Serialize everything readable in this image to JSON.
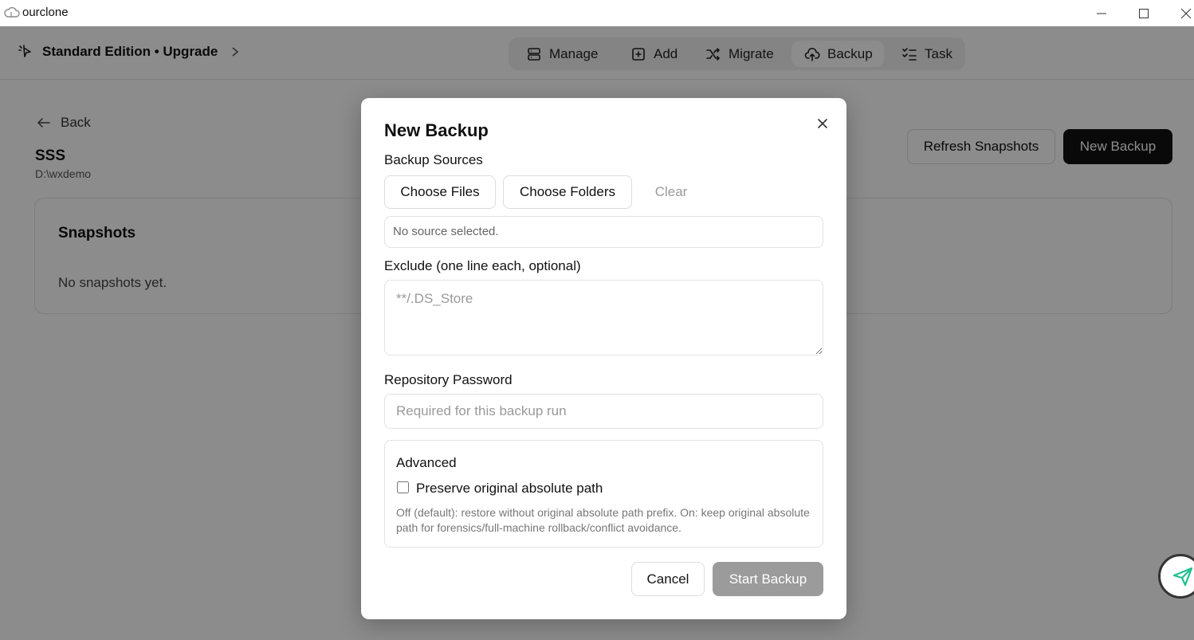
{
  "window": {
    "app_name": "ourclone",
    "icon": "cloud-icon",
    "controls": [
      "minimize-icon",
      "maximize-icon",
      "close-icon"
    ]
  },
  "header": {
    "edition_label": "Standard Edition • Upgrade",
    "nav": [
      {
        "label": "Manage",
        "icon": "database-icon",
        "active": false
      },
      {
        "label": "Add",
        "icon": "plus-square-icon",
        "active": false
      },
      {
        "label": "Migrate",
        "icon": "shuffle-icon",
        "active": false
      },
      {
        "label": "Backup",
        "icon": "cloud-upload-icon",
        "active": true
      },
      {
        "label": "Task",
        "icon": "checklist-icon",
        "active": false
      }
    ]
  },
  "page": {
    "back_label": "Back",
    "repo_name": "SSS",
    "repo_path": "D:\\wxdemo",
    "refresh_label": "Refresh Snapshots",
    "new_backup_label": "New Backup",
    "snapshots_title": "Snapshots",
    "snapshots_empty": "No snapshots yet."
  },
  "modal": {
    "title": "New Backup",
    "sources_label": "Backup Sources",
    "choose_files_label": "Choose Files",
    "choose_folders_label": "Choose Folders",
    "clear_label": "Clear",
    "source_status": "No source selected.",
    "exclude_label": "Exclude (one line each, optional)",
    "exclude_placeholder": "**/.DS_Store",
    "exclude_value": "",
    "password_label": "Repository Password",
    "password_placeholder": "Required for this backup run",
    "password_value": "",
    "advanced_title": "Advanced",
    "preserve_label": "Preserve original absolute path",
    "preserve_checked": false,
    "preserve_help": "Off (default): restore without original absolute path prefix. On: keep original absolute path for forensics/full-machine rollback/conflict avoidance.",
    "cancel_label": "Cancel",
    "start_label": "Start Backup"
  },
  "colors": {
    "primary": "#111111",
    "disabled": "#9b9b9b",
    "overlay": "rgba(0,0,0,0.45)",
    "nav_bg": "#f1f1f3",
    "widget_accent": "#1fbf8f"
  }
}
